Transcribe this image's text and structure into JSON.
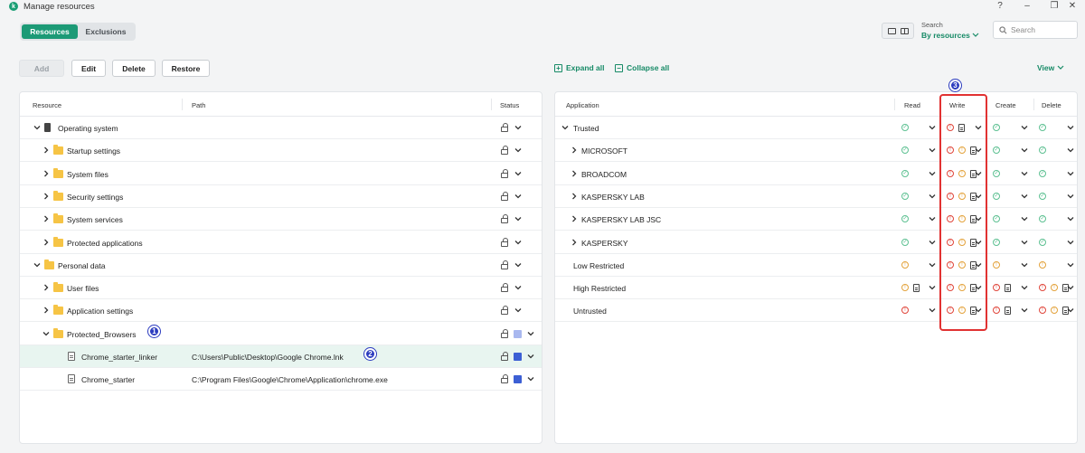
{
  "window": {
    "title": "Manage resources",
    "controls": [
      "?",
      "–",
      "❐",
      "✕"
    ]
  },
  "tabs": [
    {
      "label": "Resources",
      "active": true
    },
    {
      "label": "Exclusions",
      "active": false
    }
  ],
  "toolbar": {
    "add": "Add",
    "edit": "Edit",
    "delete": "Delete",
    "restore": "Restore",
    "expand_all": "Expand all",
    "collapse_all": "Collapse all",
    "view": "View"
  },
  "search": {
    "label": "Search",
    "mode": "By resources",
    "placeholder": "Search"
  },
  "resources": {
    "columns": [
      "Resource",
      "Path",
      "Status"
    ],
    "rows": [
      {
        "name": "Operating system",
        "path": "",
        "indent": 0,
        "expanded": true,
        "icon": "os"
      },
      {
        "name": "Startup settings",
        "path": "",
        "indent": 1,
        "expanded": false,
        "icon": "folder"
      },
      {
        "name": "System files",
        "path": "",
        "indent": 1,
        "expanded": false,
        "icon": "folder"
      },
      {
        "name": "Security settings",
        "path": "",
        "indent": 1,
        "expanded": false,
        "icon": "folder"
      },
      {
        "name": "System services",
        "path": "",
        "indent": 1,
        "expanded": false,
        "icon": "folder"
      },
      {
        "name": "Protected applications",
        "path": "",
        "indent": 1,
        "expanded": false,
        "icon": "folder"
      },
      {
        "name": "Personal data",
        "path": "",
        "indent": 0,
        "expanded": true,
        "icon": "folder"
      },
      {
        "name": "User files",
        "path": "",
        "indent": 1,
        "expanded": false,
        "icon": "folder"
      },
      {
        "name": "Application settings",
        "path": "",
        "indent": 1,
        "expanded": false,
        "icon": "folder"
      },
      {
        "name": "Protected_Browsers",
        "path": "",
        "indent": 1,
        "expanded": true,
        "icon": "folder",
        "status_color": "#a9b8ef"
      },
      {
        "name": "Chrome_starter_linker",
        "path": "C:\\Users\\Public\\Desktop\\Google Chrome.lnk",
        "indent": 2,
        "icon": "file",
        "selected": true,
        "status_color": "#3c5fd4"
      },
      {
        "name": "Chrome_starter",
        "path": "C:\\Program Files\\Google\\Chrome\\Application\\chrome.exe",
        "indent": 2,
        "icon": "file",
        "status_color": "#3c5fd4"
      }
    ]
  },
  "applications": {
    "columns": [
      "Application",
      "Read",
      "Write",
      "Create",
      "Delete"
    ],
    "rows": [
      {
        "name": "Trusted",
        "indent": 0,
        "expander": "down",
        "read": [
          "ok"
        ],
        "write": [
          "bad",
          "page"
        ],
        "create": [
          "ok"
        ],
        "delete": [
          "ok"
        ]
      },
      {
        "name": "MICROSOFT",
        "indent": 1,
        "expander": "right",
        "read": [
          "ok"
        ],
        "write": [
          "bad",
          "warn",
          "page"
        ],
        "create": [
          "ok"
        ],
        "delete": [
          "ok"
        ]
      },
      {
        "name": "BROADCOM",
        "indent": 1,
        "expander": "right",
        "read": [
          "ok"
        ],
        "write": [
          "bad",
          "warn",
          "page"
        ],
        "create": [
          "ok"
        ],
        "delete": [
          "ok"
        ]
      },
      {
        "name": "KASPERSKY LAB",
        "indent": 1,
        "expander": "right",
        "read": [
          "ok"
        ],
        "write": [
          "bad",
          "warn",
          "page"
        ],
        "create": [
          "ok"
        ],
        "delete": [
          "ok"
        ]
      },
      {
        "name": "KASPERSKY LAB JSC",
        "indent": 1,
        "expander": "right",
        "read": [
          "ok"
        ],
        "write": [
          "bad",
          "warn",
          "page"
        ],
        "create": [
          "ok"
        ],
        "delete": [
          "ok"
        ]
      },
      {
        "name": "KASPERSKY",
        "indent": 1,
        "expander": "right",
        "read": [
          "ok"
        ],
        "write": [
          "bad",
          "warn",
          "page"
        ],
        "create": [
          "ok"
        ],
        "delete": [
          "ok"
        ]
      },
      {
        "name": "Low Restricted",
        "indent": 0,
        "expander": "",
        "read": [
          "warn"
        ],
        "write": [
          "bad",
          "warn",
          "page"
        ],
        "create": [
          "warn"
        ],
        "delete": [
          "warn"
        ]
      },
      {
        "name": "High Restricted",
        "indent": 0,
        "expander": "",
        "read": [
          "warn",
          "page"
        ],
        "write": [
          "bad",
          "warn",
          "page"
        ],
        "create": [
          "bad",
          "page"
        ],
        "delete": [
          "bad",
          "warn",
          "page"
        ]
      },
      {
        "name": "Untrusted",
        "indent": 0,
        "expander": "",
        "read": [
          "bad"
        ],
        "write": [
          "bad",
          "warn",
          "page"
        ],
        "create": [
          "bad",
          "page"
        ],
        "delete": [
          "bad",
          "warn",
          "page"
        ]
      }
    ]
  },
  "annotations": [
    "1",
    "2",
    "3"
  ],
  "colors": {
    "accent": "#1c9a76",
    "ok": "#5cc091",
    "warn": "#e3a23a",
    "bad": "#e0453a",
    "highlight_box": "#e13232",
    "badge": "#2c3cbf"
  }
}
